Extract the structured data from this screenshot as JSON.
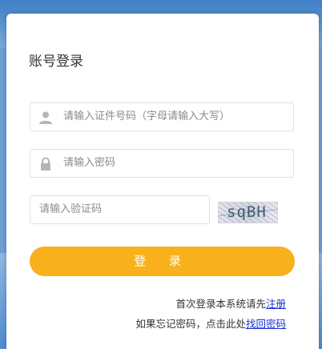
{
  "form": {
    "title": "账号登录",
    "id_field": {
      "placeholder": "请输入证件号码（字母请输入大写）",
      "icon": "user-icon"
    },
    "password_field": {
      "placeholder": "请输入密码",
      "icon": "lock-icon"
    },
    "captcha_field": {
      "placeholder": "请输入验证码"
    },
    "captcha_image_text": "sqBH",
    "login_button": "登 录",
    "register_prompt": "首次登录本系统请先",
    "register_link": "注册",
    "forgot_prompt": "如果忘记密码，点击此处",
    "forgot_link": "找回密码"
  },
  "colors": {
    "accent": "#f8b11c",
    "link": "#1a2fd6",
    "background": "#6f9fd3"
  }
}
